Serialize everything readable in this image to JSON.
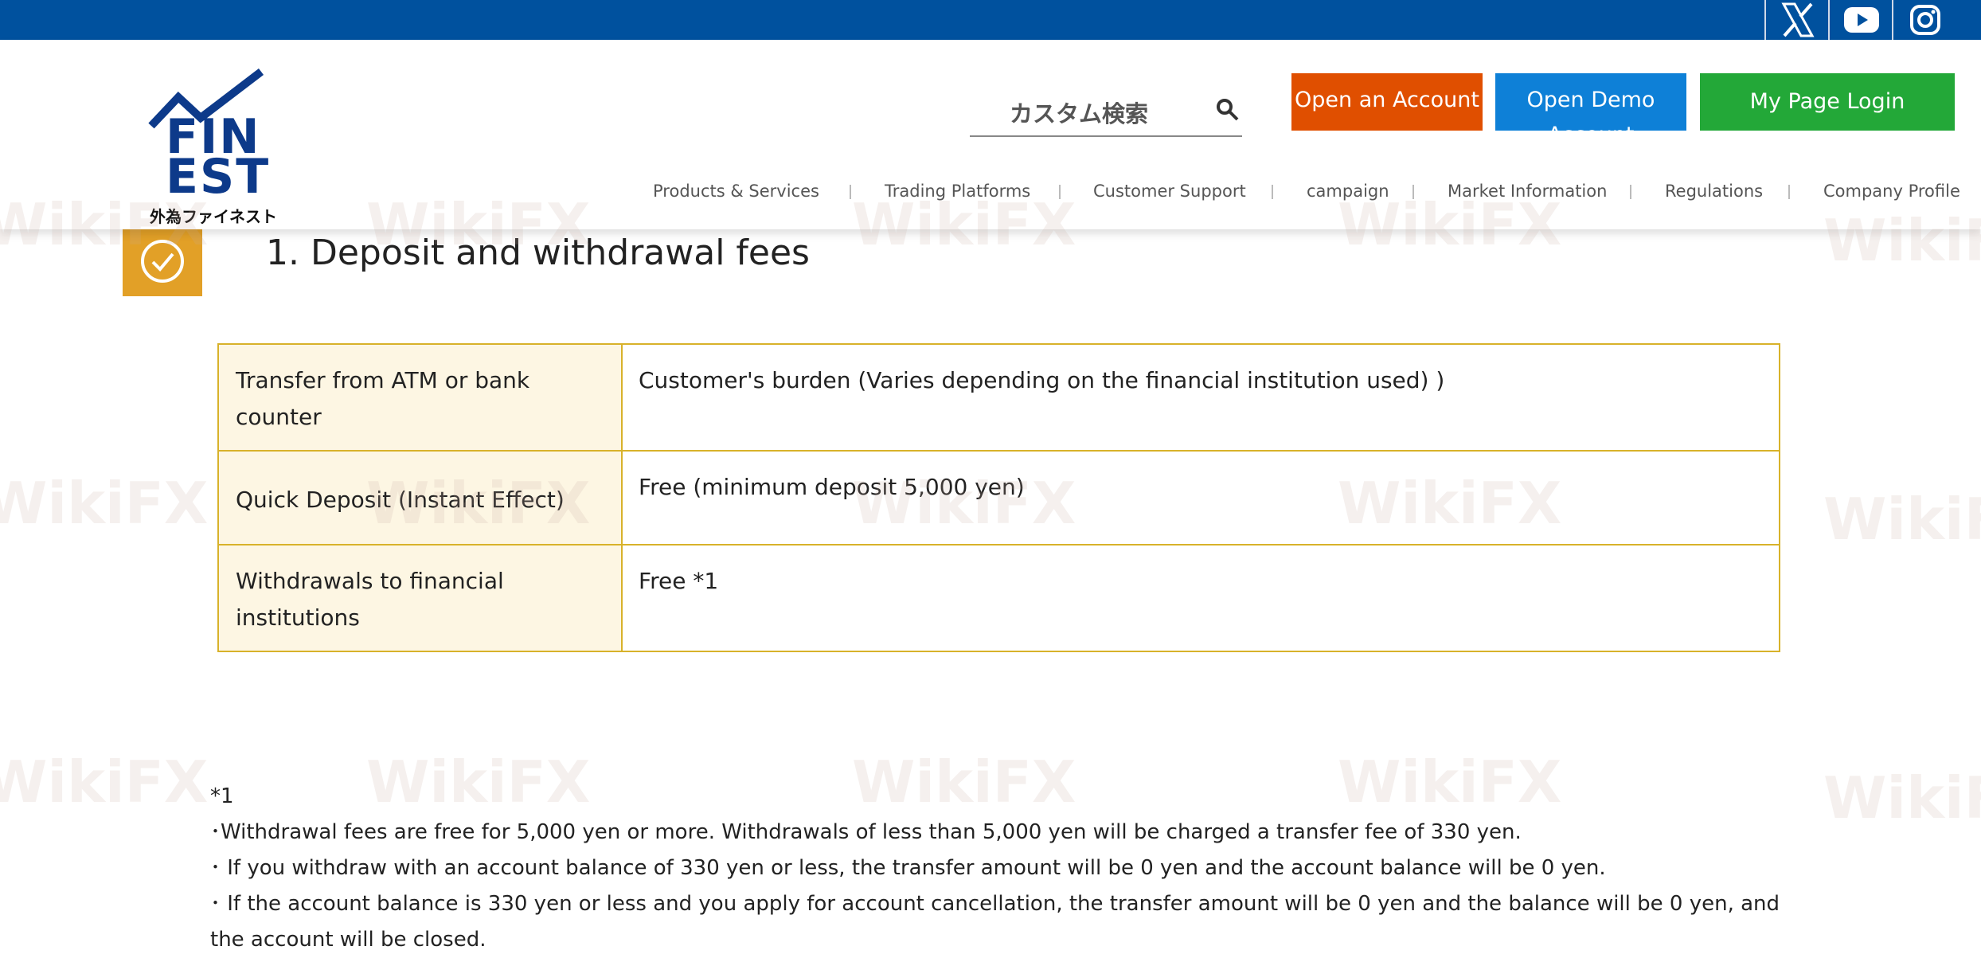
{
  "social": {
    "x_icon": "x-icon",
    "youtube_icon": "youtube-icon",
    "instagram_icon": "instagram-icon"
  },
  "logo": {
    "line1": "FIN",
    "line2": "EST",
    "tagline": "外為ファイネスト"
  },
  "search": {
    "placeholder": "カスタム検索"
  },
  "buttons": {
    "open_account": "Open an Account",
    "open_demo": "Open Demo Account",
    "login": "My Page Login"
  },
  "nav": [
    "Products & Services",
    "Trading Platforms",
    "Customer Support",
    "campaign",
    "Market Information",
    "Regulations",
    "Company Profile"
  ],
  "section": {
    "title": "1. Deposit and withdrawal fees"
  },
  "fees": [
    {
      "label": "Transfer from ATM or bank counter",
      "value": "Customer's burden (Varies depending on the financial institution used) )"
    },
    {
      "label": "Quick Deposit (Instant Effect)",
      "value": "Free (minimum deposit 5,000 yen)"
    },
    {
      "label": "Withdrawals to financial institutions",
      "value": "Free *1"
    }
  ],
  "notes": [
    "*1",
    "･Withdrawal fees are free for 5,000 yen or more. Withdrawals of less than 5,000 yen will be charged a transfer fee of 330 yen.",
    "･ If you withdraw with an account balance of 330 yen or less, the transfer amount will be 0 yen and the account balance will be 0 yen.",
    "･ If the account balance is 330 yen or less and you apply for account cancellation, the transfer amount will be 0 yen and the balance will be 0 yen, and the account will be closed."
  ],
  "watermark": "WikiFX",
  "colors": {
    "topbar": "#00519e",
    "open_account": "#e04f00",
    "open_demo": "#0e80d7",
    "login": "#23a838",
    "accent": "#e2a027",
    "table_border": "#d8b22a",
    "label_bg": "#fdf6e3"
  }
}
